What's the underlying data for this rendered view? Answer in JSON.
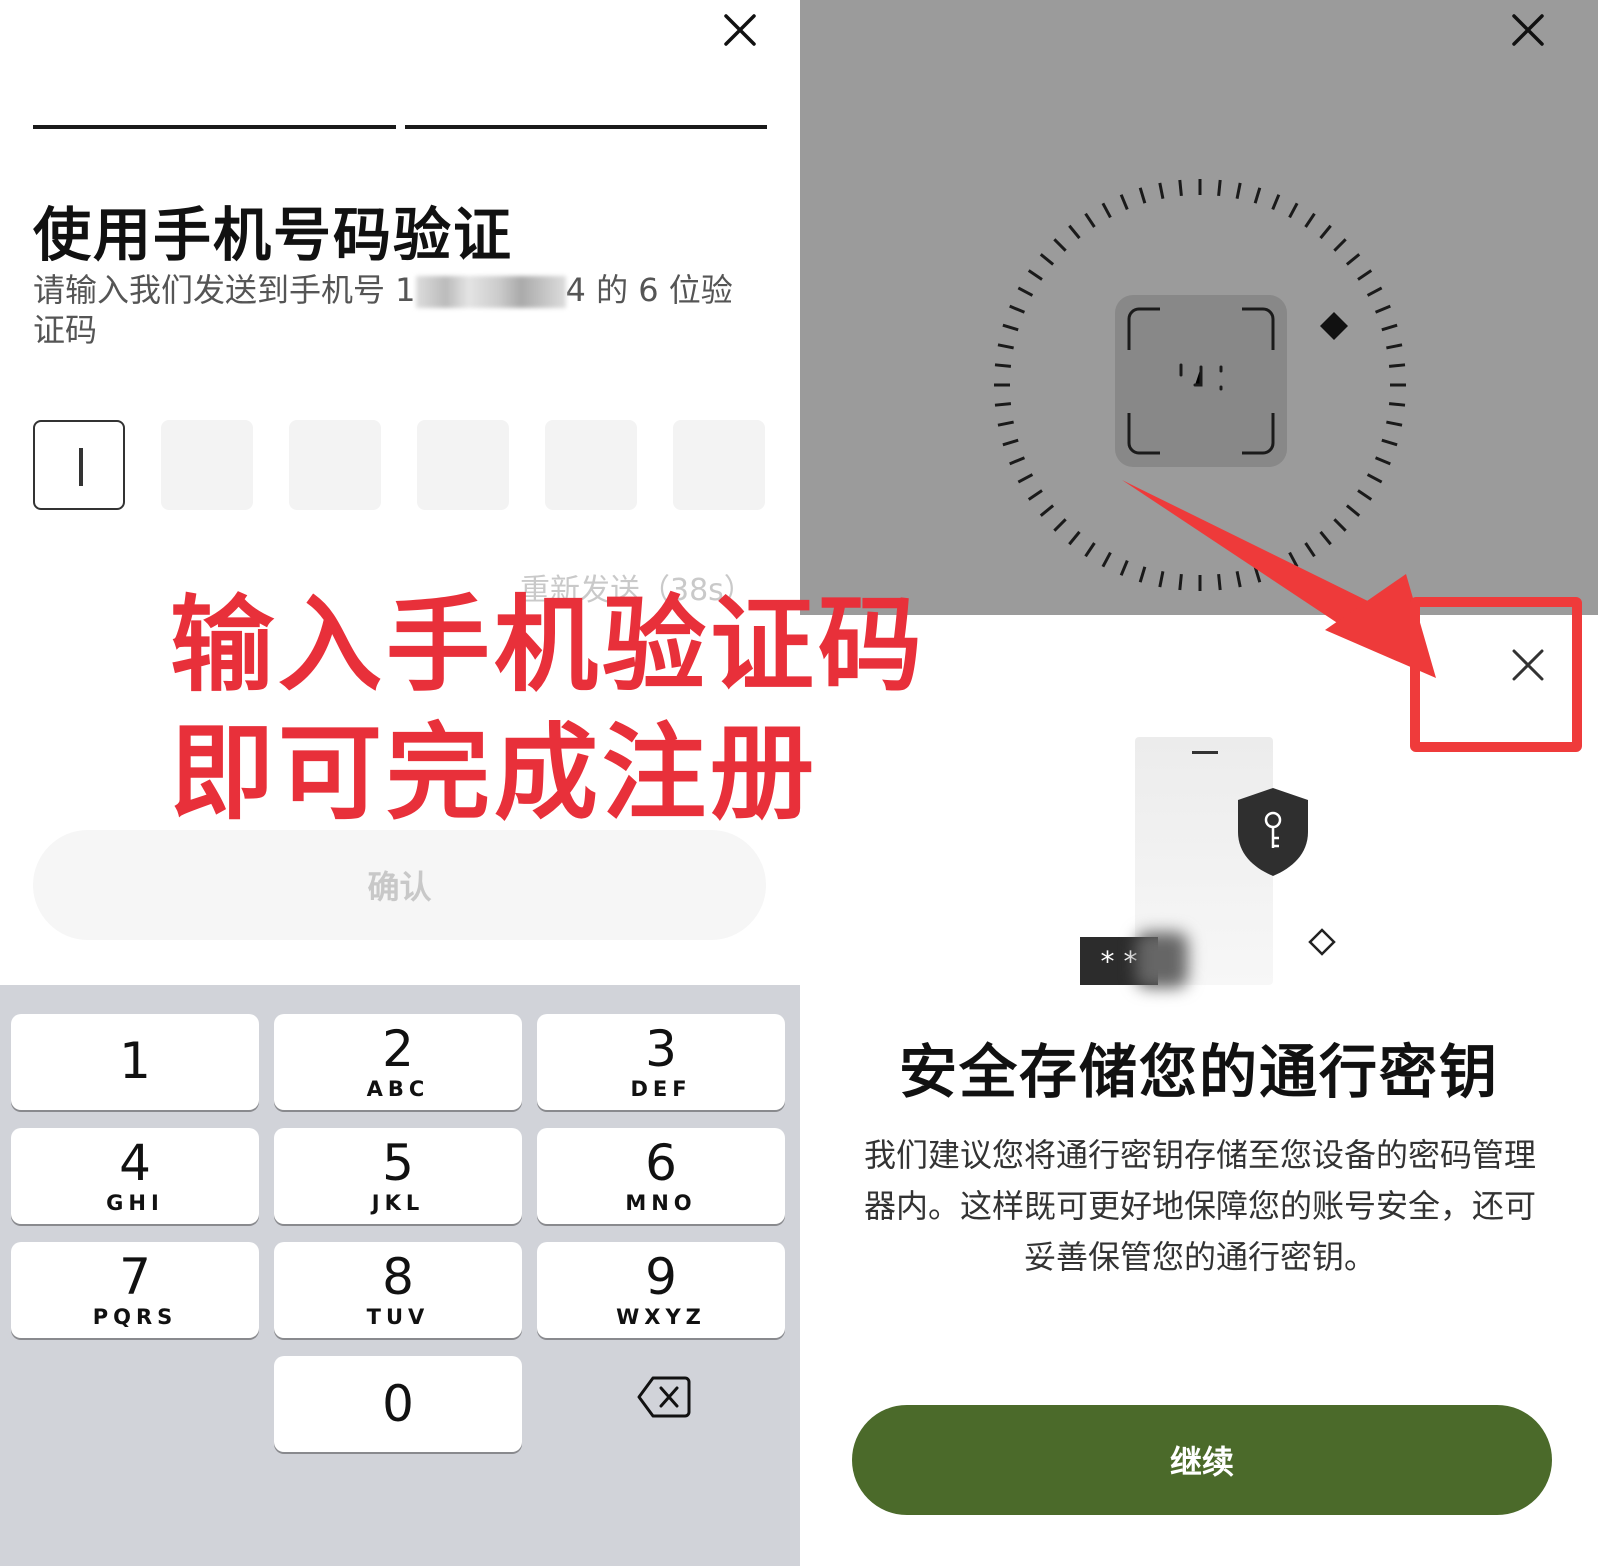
{
  "left": {
    "title": "使用手机号码验证",
    "subtitle_prefix": "请输入我们发送到手机号 1",
    "subtitle_suffix": "4 的 6 位验证码",
    "resend": "重新发送（38s）",
    "confirm_label": "确认",
    "keypad": [
      {
        "digit": "1",
        "letters": ""
      },
      {
        "digit": "2",
        "letters": "ABC"
      },
      {
        "digit": "3",
        "letters": "DEF"
      },
      {
        "digit": "4",
        "letters": "GHI"
      },
      {
        "digit": "5",
        "letters": "JKL"
      },
      {
        "digit": "6",
        "letters": "MNO"
      },
      {
        "digit": "7",
        "letters": "PQRS"
      },
      {
        "digit": "8",
        "letters": "TUV"
      },
      {
        "digit": "9",
        "letters": "WXYZ"
      },
      {
        "digit": "0",
        "letters": ""
      }
    ]
  },
  "right": {
    "title": "安全存储您的通行密钥",
    "description": "我们建议您将通行密钥存储至您设备的密码管理器内。这样既可更好地保障您的账号安全，还可妥善保管您的通行密钥。",
    "password_chip": "* *",
    "continue_label": "继续"
  },
  "annotation": {
    "line1": "输入手机验证码",
    "line2": "即可完成注册",
    "color": "#e8303a"
  },
  "colors": {
    "continue_button": "#4b6a2a",
    "scanner_background": "#9b9b9b",
    "keypad_background": "#d1d3d9"
  }
}
